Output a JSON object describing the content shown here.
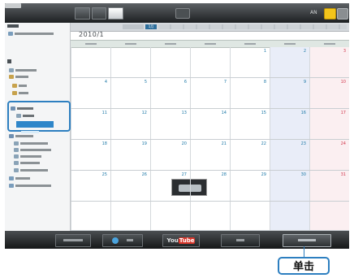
{
  "toolbar": {
    "view_buttons": [
      "",
      "",
      ""
    ],
    "right_label": "AN"
  },
  "calendar": {
    "title": "2010/1",
    "nav_month": "1月",
    "weekdays": [
      "",
      "",
      "",
      "",
      "",
      "",
      ""
    ],
    "weeks": [
      [
        "",
        "",
        "",
        "",
        "1",
        "2",
        "3"
      ],
      [
        "4",
        "5",
        "6",
        "7",
        "8",
        "9",
        "10"
      ],
      [
        "11",
        "12",
        "13",
        "14",
        "15",
        "16",
        "17"
      ],
      [
        "18",
        "19",
        "20",
        "21",
        "22",
        "23",
        "24"
      ],
      [
        "25",
        "26",
        "27",
        "28",
        "29",
        "30",
        "31"
      ],
      [
        "",
        "",
        "",
        "",
        "",
        "",
        ""
      ]
    ]
  },
  "colors": {
    "accent": "#2d7fc0",
    "saturday_bg": "#e9edf8",
    "sunday_bg": "#fbeff1",
    "youtube_red": "#d8362a"
  },
  "bottom_buttons": {
    "yt_you": "You",
    "yt_tube": "Tube"
  },
  "callout": {
    "text": "单击"
  }
}
